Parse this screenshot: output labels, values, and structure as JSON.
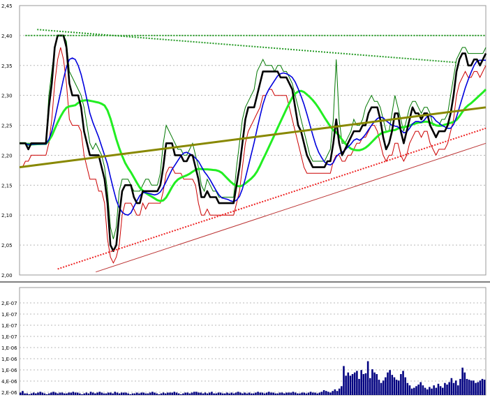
{
  "chart_data": [
    {
      "type": "line",
      "title": "",
      "xlabel": "",
      "ylabel": "",
      "ylim": [
        2.0,
        2.45
      ],
      "yticks": [
        "2,45",
        "2,40",
        "2,35",
        "2,30",
        "2,25",
        "2,20",
        "2,15",
        "2,10",
        "2,05",
        "2,00"
      ],
      "x_count": 160,
      "grid": true,
      "series": [
        {
          "key": "close",
          "color": "#000000",
          "values": [
            2.22,
            2.22,
            2.22,
            2.21,
            2.22,
            2.22,
            2.22,
            2.22,
            2.22,
            2.22,
            2.28,
            2.32,
            2.38,
            2.4,
            2.4,
            2.4,
            2.38,
            2.32,
            2.3,
            2.3,
            2.3,
            2.28,
            2.24,
            2.22,
            2.2,
            2.2,
            2.2,
            2.2,
            2.18,
            2.16,
            2.12,
            2.05,
            2.04,
            2.05,
            2.1,
            2.14,
            2.15,
            2.15,
            2.15,
            2.13,
            2.12,
            2.12,
            2.14,
            2.14,
            2.14,
            2.14,
            2.14,
            2.14,
            2.15,
            2.18,
            2.22,
            2.22,
            2.22,
            2.2,
            2.2,
            2.2,
            2.19,
            2.19,
            2.2,
            2.2,
            2.18,
            2.16,
            2.13,
            2.13,
            2.14,
            2.13,
            2.13,
            2.13,
            2.12,
            2.12,
            2.12,
            2.12,
            2.12,
            2.12,
            2.15,
            2.18,
            2.22,
            2.26,
            2.28,
            2.28,
            2.28,
            2.3,
            2.32,
            2.34,
            2.34,
            2.34,
            2.34,
            2.34,
            2.34,
            2.33,
            2.33,
            2.33,
            2.32,
            2.31,
            2.28,
            2.25,
            2.24,
            2.22,
            2.2,
            2.19,
            2.18,
            2.18,
            2.18,
            2.18,
            2.18,
            2.19,
            2.19,
            2.22,
            2.26,
            2.22,
            2.2,
            2.21,
            2.22,
            2.23,
            2.24,
            2.24,
            2.24,
            2.25,
            2.25,
            2.27,
            2.28,
            2.28,
            2.28,
            2.26,
            2.23,
            2.21,
            2.22,
            2.24,
            2.27,
            2.27,
            2.24,
            2.22,
            2.24,
            2.26,
            2.28,
            2.27,
            2.27,
            2.26,
            2.27,
            2.27,
            2.25,
            2.24,
            2.23,
            2.24,
            2.24,
            2.24,
            2.25,
            2.27,
            2.3,
            2.34,
            2.36,
            2.37,
            2.37,
            2.35,
            2.35,
            2.36,
            2.36,
            2.35,
            2.36,
            2.37
          ]
        },
        {
          "key": "high",
          "color": "#007700",
          "values": [
            2.22,
            2.22,
            2.22,
            2.22,
            2.22,
            2.22,
            2.22,
            2.22,
            2.22,
            2.22,
            2.3,
            2.34,
            2.38,
            2.4,
            2.4,
            2.4,
            2.39,
            2.34,
            2.33,
            2.32,
            2.31,
            2.3,
            2.28,
            2.25,
            2.22,
            2.21,
            2.22,
            2.21,
            2.2,
            2.18,
            2.14,
            2.08,
            2.06,
            2.08,
            2.14,
            2.16,
            2.16,
            2.16,
            2.15,
            2.14,
            2.14,
            2.14,
            2.15,
            2.16,
            2.16,
            2.15,
            2.15,
            2.15,
            2.17,
            2.22,
            2.25,
            2.24,
            2.23,
            2.22,
            2.21,
            2.21,
            2.2,
            2.2,
            2.21,
            2.22,
            2.2,
            2.18,
            2.15,
            2.14,
            2.16,
            2.15,
            2.14,
            2.14,
            2.13,
            2.13,
            2.13,
            2.13,
            2.13,
            2.13,
            2.18,
            2.22,
            2.26,
            2.28,
            2.29,
            2.3,
            2.31,
            2.34,
            2.35,
            2.36,
            2.35,
            2.35,
            2.35,
            2.34,
            2.35,
            2.35,
            2.34,
            2.34,
            2.33,
            2.32,
            2.3,
            2.28,
            2.26,
            2.24,
            2.22,
            2.2,
            2.19,
            2.19,
            2.19,
            2.19,
            2.19,
            2.2,
            2.21,
            2.26,
            2.36,
            2.26,
            2.22,
            2.22,
            2.23,
            2.24,
            2.26,
            2.25,
            2.25,
            2.26,
            2.28,
            2.29,
            2.3,
            2.29,
            2.29,
            2.28,
            2.26,
            2.24,
            2.24,
            2.27,
            2.3,
            2.28,
            2.26,
            2.24,
            2.26,
            2.28,
            2.29,
            2.29,
            2.28,
            2.27,
            2.28,
            2.28,
            2.27,
            2.25,
            2.25,
            2.25,
            2.26,
            2.26,
            2.27,
            2.3,
            2.33,
            2.36,
            2.37,
            2.38,
            2.38,
            2.37,
            2.37,
            2.37,
            2.37,
            2.37,
            2.37,
            2.38
          ]
        },
        {
          "key": "low",
          "color": "#cc0000",
          "values": [
            2.18,
            2.18,
            2.19,
            2.19,
            2.2,
            2.2,
            2.2,
            2.2,
            2.2,
            2.2,
            2.22,
            2.26,
            2.32,
            2.36,
            2.38,
            2.36,
            2.32,
            2.26,
            2.25,
            2.25,
            2.25,
            2.24,
            2.2,
            2.18,
            2.16,
            2.16,
            2.16,
            2.14,
            2.14,
            2.12,
            2.06,
            2.03,
            2.02,
            2.03,
            2.05,
            2.1,
            2.12,
            2.12,
            2.12,
            2.11,
            2.1,
            2.1,
            2.12,
            2.11,
            2.12,
            2.12,
            2.12,
            2.12,
            2.12,
            2.14,
            2.17,
            2.18,
            2.18,
            2.17,
            2.17,
            2.17,
            2.16,
            2.16,
            2.16,
            2.16,
            2.15,
            2.12,
            2.1,
            2.1,
            2.11,
            2.1,
            2.1,
            2.1,
            2.1,
            2.1,
            2.1,
            2.1,
            2.1,
            2.1,
            2.12,
            2.14,
            2.18,
            2.22,
            2.24,
            2.25,
            2.26,
            2.27,
            2.28,
            2.3,
            2.3,
            2.31,
            2.31,
            2.3,
            2.3,
            2.3,
            2.3,
            2.3,
            2.28,
            2.26,
            2.24,
            2.22,
            2.2,
            2.18,
            2.17,
            2.17,
            2.17,
            2.17,
            2.17,
            2.17,
            2.17,
            2.17,
            2.17,
            2.19,
            2.2,
            2.2,
            2.19,
            2.19,
            2.2,
            2.2,
            2.21,
            2.22,
            2.22,
            2.23,
            2.23,
            2.24,
            2.25,
            2.25,
            2.24,
            2.22,
            2.2,
            2.19,
            2.2,
            2.2,
            2.22,
            2.22,
            2.2,
            2.19,
            2.2,
            2.22,
            2.23,
            2.24,
            2.24,
            2.23,
            2.24,
            2.24,
            2.22,
            2.21,
            2.2,
            2.21,
            2.21,
            2.21,
            2.22,
            2.24,
            2.26,
            2.3,
            2.32,
            2.33,
            2.34,
            2.33,
            2.33,
            2.34,
            2.34,
            2.33,
            2.34,
            2.35
          ]
        }
      ],
      "moving_averages": [
        {
          "key": "ma_short",
          "color": "#0000dd",
          "window": 8
        },
        {
          "key": "ma_long",
          "color": "#22ee22",
          "window": 20
        }
      ],
      "trendlines": [
        {
          "key": "resistance-top",
          "color": "#229922",
          "style": "dotted",
          "x1": 2,
          "y1": 2.4,
          "x2": 159,
          "y2": 2.4
        },
        {
          "key": "resistance-descending",
          "color": "#229922",
          "style": "dotted",
          "x1": 6,
          "y1": 2.41,
          "x2": 149,
          "y2": 2.355
        },
        {
          "key": "mid-trend",
          "color": "#888800",
          "style": "solid",
          "x1": 0,
          "y1": 2.18,
          "x2": 159,
          "y2": 2.28
        },
        {
          "key": "support-lower",
          "color": "#ee2222",
          "style": "dotted",
          "x1": 13,
          "y1": 2.01,
          "x2": 159,
          "y2": 2.245
        },
        {
          "key": "support-bottom",
          "color": "#bb3333",
          "style": "solid",
          "x1": 26,
          "y1": 2.005,
          "x2": 159,
          "y2": 2.22
        }
      ]
    },
    {
      "type": "bar",
      "title": "",
      "xlabel": "",
      "ylabel": "",
      "ylim": [
        0,
        10000000
      ],
      "yticks": [
        "2,E-07",
        "1,E-07",
        "1,E-07",
        "1,E-07",
        "1,E-06",
        "1,E-06",
        "1,E-06",
        "4,E-06",
        "2,E-06"
      ],
      "color": "#000080",
      "values": [
        0.3,
        0.5,
        0.2,
        0.2,
        0.1,
        0.2,
        0.3,
        0.2,
        0.3,
        0.4,
        0.3,
        0.2,
        0.1,
        0.2,
        0.3,
        0.4,
        0.3,
        0.2,
        0.3,
        0.3,
        0.2,
        0.2,
        0.3,
        0.3,
        0.4,
        0.3,
        0.3,
        0.2,
        0.1,
        0.2,
        0.3,
        0.2,
        0.4,
        0.3,
        0.2,
        0.3,
        0.4,
        0.3,
        0.2,
        0.2,
        0.3,
        0.3,
        0.2,
        0.4,
        0.3,
        0.2,
        0.3,
        0.3,
        0.3,
        0.2,
        0.1,
        0.2,
        0.2,
        0.3,
        0.2,
        0.3,
        0.3,
        0.2,
        0.2,
        0.3,
        0.4,
        0.3,
        0.2,
        0.1,
        0.2,
        0.3,
        0.2,
        0.3,
        0.3,
        0.3,
        0.4,
        0.3,
        0.2,
        0.1,
        0.2,
        0.3,
        0.3,
        0.2,
        0.3,
        0.4,
        0.4,
        0.3,
        0.3,
        0.2,
        0.3,
        0.2,
        0.3,
        0.4,
        0.2,
        0.2,
        0.3,
        0.3,
        0.2,
        0.2,
        0.3,
        0.2,
        0.3,
        0.2,
        0.3,
        0.4,
        0.3,
        0.2,
        0.3,
        0.2,
        0.3,
        0.2,
        0.2,
        0.3,
        0.4,
        0.3,
        0.3,
        0.2,
        0.3,
        0.4,
        0.3,
        0.3,
        0.2,
        0.2,
        0.3,
        0.3,
        0.2,
        0.3,
        0.3,
        0.3,
        0.4,
        0.3,
        0.2,
        0.2,
        0.3,
        0.3,
        0.2,
        0.3,
        0.4,
        0.3,
        0.3,
        0.2,
        0.3,
        0.4,
        0.6,
        0.5,
        0.4,
        0.3,
        0.5,
        0.7,
        0.5,
        0.8,
        1.1,
        3.6,
        2.4,
        2.8,
        2.4,
        2.6,
        2.8,
        3.0,
        2.0,
        3.1,
        2.6,
        2.7,
        4.2,
        2.1,
        3.2,
        2.8,
        2.6,
        1.9,
        1.5,
        1.8,
        2.2,
        2.8,
        3.1,
        2.5,
        2.2,
        1.9,
        1.8,
        2.6,
        3.0,
        2.2,
        1.5,
        1.2,
        0.8,
        0.9,
        1.1,
        1.3,
        1.6,
        1.2,
        0.9,
        0.7,
        1.0,
        0.8,
        1.2,
        0.9,
        1.4,
        1.1,
        0.9,
        1.5,
        1.3,
        1.6,
        2.1,
        1.5,
        1.8,
        1.2,
        2.0,
        3.4,
        2.8,
        2.0,
        1.9,
        1.8,
        1.8,
        1.5,
        1.6,
        1.8,
        2.0,
        1.9
      ],
      "max_value": 13.0
    }
  ]
}
